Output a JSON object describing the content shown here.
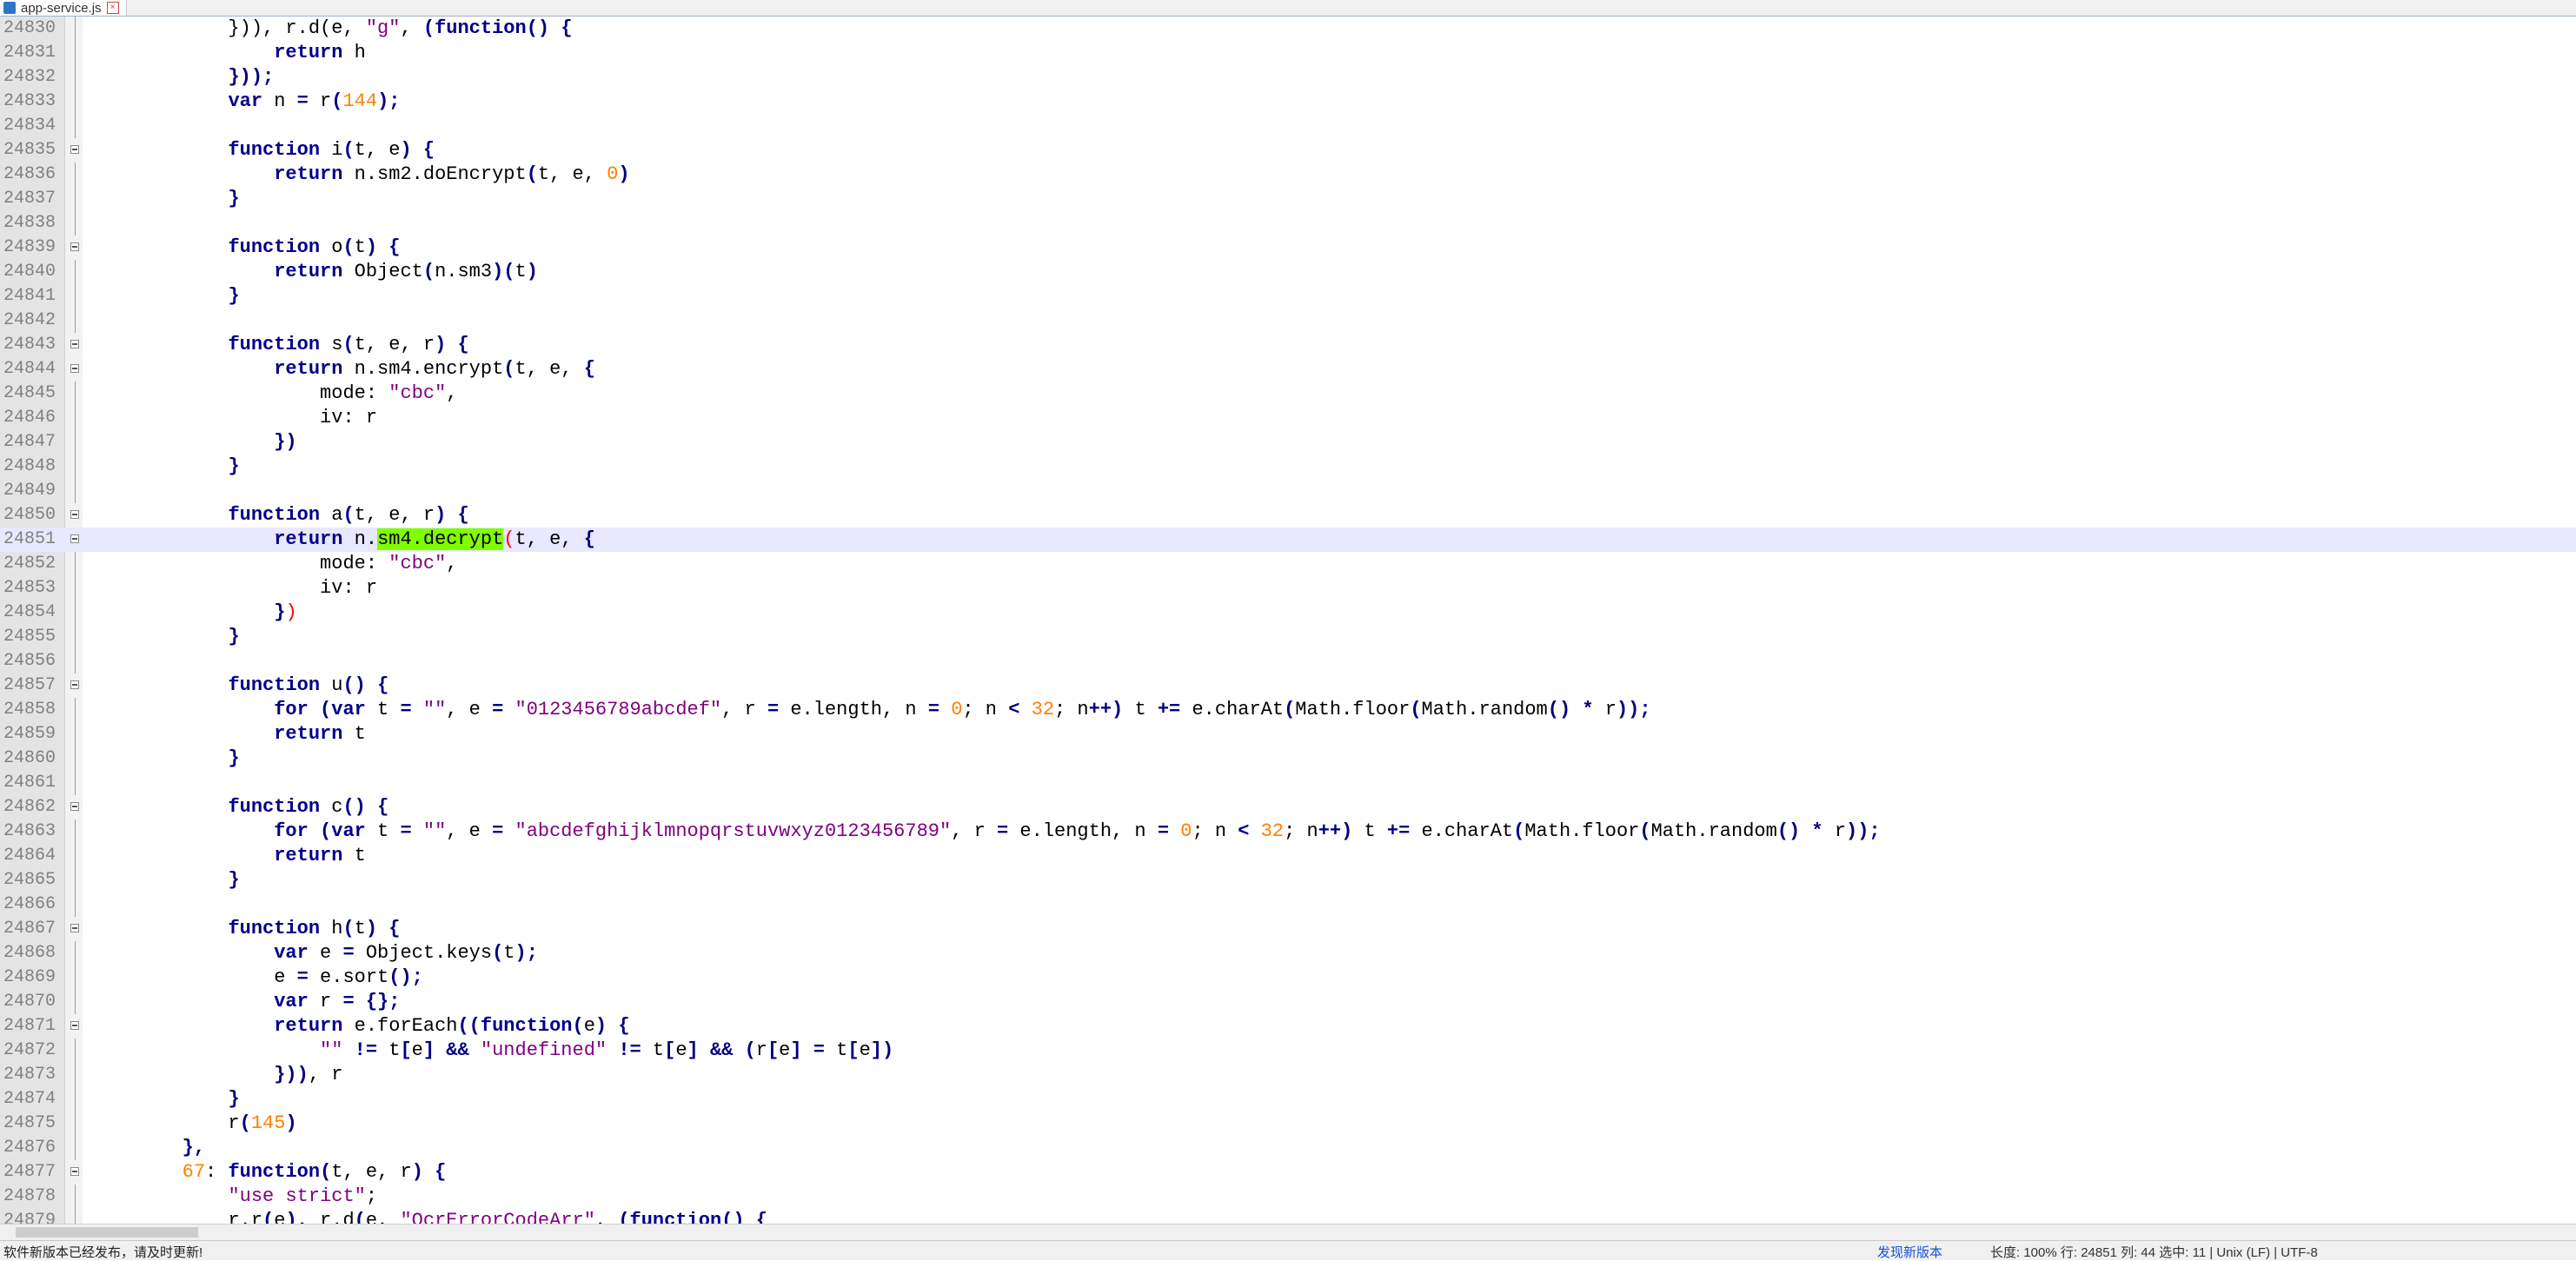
{
  "tab": {
    "filename": "app-service.js",
    "close_label": "×"
  },
  "editor": {
    "first_line": 24830,
    "current_line": 24851,
    "fold_lines": [
      24835,
      24839,
      24843,
      24844,
      24850,
      24851,
      24857,
      24862,
      24867,
      24871,
      24877
    ],
    "lines": [
      [
        [
          "p",
          "            })), r.d(e, "
        ],
        [
          "s",
          "\"g\""
        ],
        [
          "p",
          ", "
        ],
        [
          "o",
          "("
        ],
        [
          "k",
          "function"
        ],
        [
          "o",
          "()"
        ],
        [
          "p",
          " "
        ],
        [
          "o",
          "{"
        ]
      ],
      [
        [
          "p",
          "                "
        ],
        [
          "k",
          "return"
        ],
        [
          "p",
          " h"
        ]
      ],
      [
        [
          "p",
          "            "
        ],
        [
          "o",
          "}));"
        ]
      ],
      [
        [
          "p",
          "            "
        ],
        [
          "k",
          "var"
        ],
        [
          "p",
          " n "
        ],
        [
          "o",
          "="
        ],
        [
          "p",
          " r"
        ],
        [
          "o",
          "("
        ],
        [
          "n",
          "144"
        ],
        [
          "o",
          ");"
        ]
      ],
      [],
      [
        [
          "p",
          "            "
        ],
        [
          "k",
          "function"
        ],
        [
          "p",
          " i"
        ],
        [
          "o",
          "("
        ],
        [
          "p",
          "t, e"
        ],
        [
          "o",
          ")"
        ],
        [
          "p",
          " "
        ],
        [
          "o",
          "{"
        ]
      ],
      [
        [
          "p",
          "                "
        ],
        [
          "k",
          "return"
        ],
        [
          "p",
          " n.sm2.doEncrypt"
        ],
        [
          "o",
          "("
        ],
        [
          "p",
          "t, e, "
        ],
        [
          "n",
          "0"
        ],
        [
          "o",
          ")"
        ]
      ],
      [
        [
          "p",
          "            "
        ],
        [
          "o",
          "}"
        ]
      ],
      [],
      [
        [
          "p",
          "            "
        ],
        [
          "k",
          "function"
        ],
        [
          "p",
          " o"
        ],
        [
          "o",
          "("
        ],
        [
          "p",
          "t"
        ],
        [
          "o",
          ")"
        ],
        [
          "p",
          " "
        ],
        [
          "o",
          "{"
        ]
      ],
      [
        [
          "p",
          "                "
        ],
        [
          "k",
          "return"
        ],
        [
          "p",
          " Object"
        ],
        [
          "o",
          "("
        ],
        [
          "p",
          "n.sm3"
        ],
        [
          "o",
          ")("
        ],
        [
          "p",
          "t"
        ],
        [
          "o",
          ")"
        ]
      ],
      [
        [
          "p",
          "            "
        ],
        [
          "o",
          "}"
        ]
      ],
      [],
      [
        [
          "p",
          "            "
        ],
        [
          "k",
          "function"
        ],
        [
          "p",
          " s"
        ],
        [
          "o",
          "("
        ],
        [
          "p",
          "t, e, r"
        ],
        [
          "o",
          ")"
        ],
        [
          "p",
          " "
        ],
        [
          "o",
          "{"
        ]
      ],
      [
        [
          "p",
          "                "
        ],
        [
          "k",
          "return"
        ],
        [
          "p",
          " n.sm4.encrypt"
        ],
        [
          "o",
          "("
        ],
        [
          "p",
          "t, e, "
        ],
        [
          "o",
          "{"
        ]
      ],
      [
        [
          "p",
          "                    mode: "
        ],
        [
          "s",
          "\"cbc\""
        ],
        [
          "p",
          ","
        ]
      ],
      [
        [
          "p",
          "                    iv: r"
        ]
      ],
      [
        [
          "p",
          "                "
        ],
        [
          "o",
          "})"
        ]
      ],
      [
        [
          "p",
          "            "
        ],
        [
          "o",
          "}"
        ]
      ],
      [],
      [
        [
          "p",
          "            "
        ],
        [
          "k",
          "function"
        ],
        [
          "p",
          " a"
        ],
        [
          "o",
          "("
        ],
        [
          "p",
          "t, e, r"
        ],
        [
          "o",
          ")"
        ],
        [
          "p",
          " "
        ],
        [
          "o",
          "{"
        ]
      ],
      [
        [
          "p",
          "                "
        ],
        [
          "k",
          "return"
        ],
        [
          "p",
          " n."
        ],
        [
          "h",
          "sm4.decrypt"
        ],
        [
          "r",
          "("
        ],
        [
          "p",
          "t, e, "
        ],
        [
          "o",
          "{"
        ]
      ],
      [
        [
          "p",
          "                    mode: "
        ],
        [
          "s",
          "\"cbc\""
        ],
        [
          "p",
          ","
        ]
      ],
      [
        [
          "p",
          "                    iv: r"
        ]
      ],
      [
        [
          "p",
          "                "
        ],
        [
          "o",
          "}"
        ],
        [
          "r",
          ")"
        ]
      ],
      [
        [
          "p",
          "            "
        ],
        [
          "o",
          "}"
        ]
      ],
      [],
      [
        [
          "p",
          "            "
        ],
        [
          "k",
          "function"
        ],
        [
          "p",
          " u"
        ],
        [
          "o",
          "()"
        ],
        [
          "p",
          " "
        ],
        [
          "o",
          "{"
        ]
      ],
      [
        [
          "p",
          "                "
        ],
        [
          "k",
          "for"
        ],
        [
          "p",
          " "
        ],
        [
          "o",
          "("
        ],
        [
          "k",
          "var"
        ],
        [
          "p",
          " t "
        ],
        [
          "o",
          "="
        ],
        [
          "p",
          " "
        ],
        [
          "s",
          "\"\""
        ],
        [
          "p",
          ", e "
        ],
        [
          "o",
          "="
        ],
        [
          "p",
          " "
        ],
        [
          "s",
          "\"0123456789abcdef\""
        ],
        [
          "p",
          ", r "
        ],
        [
          "o",
          "="
        ],
        [
          "p",
          " e.length, n "
        ],
        [
          "o",
          "="
        ],
        [
          "p",
          " "
        ],
        [
          "n",
          "0"
        ],
        [
          "p",
          "; n "
        ],
        [
          "o",
          "<"
        ],
        [
          "p",
          " "
        ],
        [
          "n",
          "32"
        ],
        [
          "p",
          "; n"
        ],
        [
          "o",
          "++)"
        ],
        [
          "p",
          " t "
        ],
        [
          "o",
          "+="
        ],
        [
          "p",
          " e.charAt"
        ],
        [
          "o",
          "("
        ],
        [
          "p",
          "Math.floor"
        ],
        [
          "o",
          "("
        ],
        [
          "p",
          "Math.random"
        ],
        [
          "o",
          "()"
        ],
        [
          "p",
          " "
        ],
        [
          "o",
          "*"
        ],
        [
          "p",
          " r"
        ],
        [
          "o",
          "));"
        ]
      ],
      [
        [
          "p",
          "                "
        ],
        [
          "k",
          "return"
        ],
        [
          "p",
          " t"
        ]
      ],
      [
        [
          "p",
          "            "
        ],
        [
          "o",
          "}"
        ]
      ],
      [],
      [
        [
          "p",
          "            "
        ],
        [
          "k",
          "function"
        ],
        [
          "p",
          " c"
        ],
        [
          "o",
          "()"
        ],
        [
          "p",
          " "
        ],
        [
          "o",
          "{"
        ]
      ],
      [
        [
          "p",
          "                "
        ],
        [
          "k",
          "for"
        ],
        [
          "p",
          " "
        ],
        [
          "o",
          "("
        ],
        [
          "k",
          "var"
        ],
        [
          "p",
          " t "
        ],
        [
          "o",
          "="
        ],
        [
          "p",
          " "
        ],
        [
          "s",
          "\"\""
        ],
        [
          "p",
          ", e "
        ],
        [
          "o",
          "="
        ],
        [
          "p",
          " "
        ],
        [
          "s",
          "\"abcdefghijklmnopqrstuvwxyz0123456789\""
        ],
        [
          "p",
          ", r "
        ],
        [
          "o",
          "="
        ],
        [
          "p",
          " e.length, n "
        ],
        [
          "o",
          "="
        ],
        [
          "p",
          " "
        ],
        [
          "n",
          "0"
        ],
        [
          "p",
          "; n "
        ],
        [
          "o",
          "<"
        ],
        [
          "p",
          " "
        ],
        [
          "n",
          "32"
        ],
        [
          "p",
          "; n"
        ],
        [
          "o",
          "++)"
        ],
        [
          "p",
          " t "
        ],
        [
          "o",
          "+="
        ],
        [
          "p",
          " e.charAt"
        ],
        [
          "o",
          "("
        ],
        [
          "p",
          "Math.floor"
        ],
        [
          "o",
          "("
        ],
        [
          "p",
          "Math.random"
        ],
        [
          "o",
          "()"
        ],
        [
          "p",
          " "
        ],
        [
          "o",
          "*"
        ],
        [
          "p",
          " r"
        ],
        [
          "o",
          "));"
        ]
      ],
      [
        [
          "p",
          "                "
        ],
        [
          "k",
          "return"
        ],
        [
          "p",
          " t"
        ]
      ],
      [
        [
          "p",
          "            "
        ],
        [
          "o",
          "}"
        ]
      ],
      [],
      [
        [
          "p",
          "            "
        ],
        [
          "k",
          "function"
        ],
        [
          "p",
          " h"
        ],
        [
          "o",
          "("
        ],
        [
          "p",
          "t"
        ],
        [
          "o",
          ")"
        ],
        [
          "p",
          " "
        ],
        [
          "o",
          "{"
        ]
      ],
      [
        [
          "p",
          "                "
        ],
        [
          "k",
          "var"
        ],
        [
          "p",
          " e "
        ],
        [
          "o",
          "="
        ],
        [
          "p",
          " Object.keys"
        ],
        [
          "o",
          "("
        ],
        [
          "p",
          "t"
        ],
        [
          "o",
          ");"
        ]
      ],
      [
        [
          "p",
          "                e "
        ],
        [
          "o",
          "="
        ],
        [
          "p",
          " e.sort"
        ],
        [
          "o",
          "();"
        ]
      ],
      [
        [
          "p",
          "                "
        ],
        [
          "k",
          "var"
        ],
        [
          "p",
          " r "
        ],
        [
          "o",
          "="
        ],
        [
          "p",
          " "
        ],
        [
          "o",
          "{};"
        ]
      ],
      [
        [
          "p",
          "                "
        ],
        [
          "k",
          "return"
        ],
        [
          "p",
          " e.forEach"
        ],
        [
          "o",
          "(("
        ],
        [
          "k",
          "function"
        ],
        [
          "o",
          "("
        ],
        [
          "p",
          "e"
        ],
        [
          "o",
          ")"
        ],
        [
          "p",
          " "
        ],
        [
          "o",
          "{"
        ]
      ],
      [
        [
          "p",
          "                    "
        ],
        [
          "s",
          "\"\""
        ],
        [
          "p",
          " "
        ],
        [
          "o",
          "!="
        ],
        [
          "p",
          " t"
        ],
        [
          "o",
          "["
        ],
        [
          "p",
          "e"
        ],
        [
          "o",
          "]"
        ],
        [
          "p",
          " "
        ],
        [
          "o",
          "&&"
        ],
        [
          "p",
          " "
        ],
        [
          "s",
          "\"undefined\""
        ],
        [
          "p",
          " "
        ],
        [
          "o",
          "!="
        ],
        [
          "p",
          " t"
        ],
        [
          "o",
          "["
        ],
        [
          "p",
          "e"
        ],
        [
          "o",
          "]"
        ],
        [
          "p",
          " "
        ],
        [
          "o",
          "&&"
        ],
        [
          "p",
          " "
        ],
        [
          "o",
          "("
        ],
        [
          "p",
          "r"
        ],
        [
          "o",
          "["
        ],
        [
          "p",
          "e"
        ],
        [
          "o",
          "]"
        ],
        [
          "p",
          " "
        ],
        [
          "o",
          "="
        ],
        [
          "p",
          " t"
        ],
        [
          "o",
          "["
        ],
        [
          "p",
          "e"
        ],
        [
          "o",
          "])"
        ]
      ],
      [
        [
          "p",
          "                "
        ],
        [
          "o",
          "}))"
        ],
        [
          "p",
          ", r"
        ]
      ],
      [
        [
          "p",
          "            "
        ],
        [
          "o",
          "}"
        ]
      ],
      [
        [
          "p",
          "            r"
        ],
        [
          "o",
          "("
        ],
        [
          "n",
          "145"
        ],
        [
          "o",
          ")"
        ]
      ],
      [
        [
          "p",
          "        "
        ],
        [
          "o",
          "},"
        ]
      ],
      [
        [
          "p",
          "        "
        ],
        [
          "n",
          "67"
        ],
        [
          "p",
          ": "
        ],
        [
          "k",
          "function"
        ],
        [
          "o",
          "("
        ],
        [
          "p",
          "t, e, r"
        ],
        [
          "o",
          ")"
        ],
        [
          "p",
          " "
        ],
        [
          "o",
          "{"
        ]
      ],
      [
        [
          "p",
          "            "
        ],
        [
          "s",
          "\"use strict\""
        ],
        [
          "p",
          ";"
        ]
      ],
      [
        [
          "p",
          "            r.r"
        ],
        [
          "o",
          "("
        ],
        [
          "p",
          "e"
        ],
        [
          "o",
          "),"
        ],
        [
          "p",
          " r.d"
        ],
        [
          "o",
          "("
        ],
        [
          "p",
          "e, "
        ],
        [
          "s",
          "\"OcrErrorCodeArr\""
        ],
        [
          "p",
          ", "
        ],
        [
          "o",
          "("
        ],
        [
          "k",
          "function"
        ],
        [
          "o",
          "()"
        ],
        [
          "p",
          " "
        ],
        [
          "o",
          "{"
        ]
      ]
    ]
  },
  "statusbar": {
    "message": "软件新版本已经发布，请及时更新!",
    "update_link": "发现新版本",
    "info": "长度: 100% 行: 24851 列: 44 选中: 11 | Unix (LF) | UTF-8"
  }
}
